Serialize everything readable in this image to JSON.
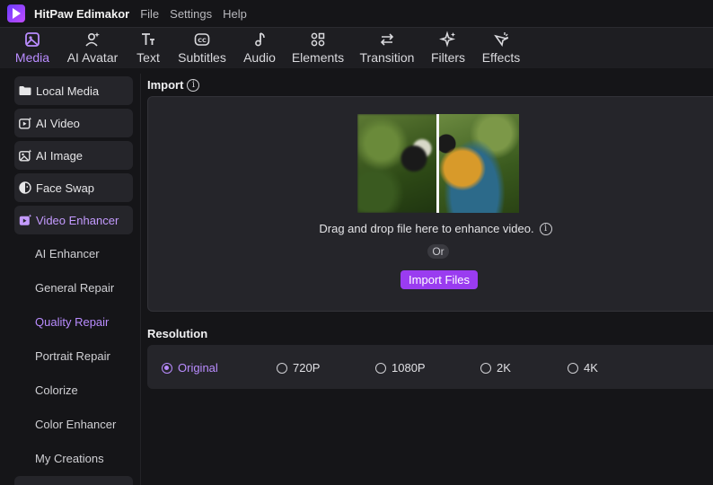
{
  "app": {
    "name": "HitPaw Edimakor",
    "menu": [
      "File",
      "Settings",
      "Help"
    ]
  },
  "toolbar": {
    "tabs": [
      {
        "label": "Media",
        "icon": "media-icon",
        "active": true
      },
      {
        "label": "AI Avatar",
        "icon": "avatar-icon"
      },
      {
        "label": "Text",
        "icon": "text-icon"
      },
      {
        "label": "Subtitles",
        "icon": "subtitles-icon"
      },
      {
        "label": "Audio",
        "icon": "audio-icon"
      },
      {
        "label": "Elements",
        "icon": "elements-icon"
      },
      {
        "label": "Transition",
        "icon": "transition-icon"
      },
      {
        "label": "Filters",
        "icon": "filters-icon"
      },
      {
        "label": "Effects",
        "icon": "effects-icon"
      }
    ]
  },
  "sidebar": {
    "items": [
      {
        "label": "Local Media",
        "icon": "folder-icon"
      },
      {
        "label": "AI Video",
        "icon": "ai-video-icon"
      },
      {
        "label": "AI Image",
        "icon": "ai-image-icon"
      },
      {
        "label": "Face Swap",
        "icon": "face-swap-icon"
      },
      {
        "label": "Video Enhancer",
        "icon": "video-enhancer-icon",
        "active": true
      }
    ],
    "sub_items": [
      {
        "label": "AI Enhancer"
      },
      {
        "label": "General Repair"
      },
      {
        "label": "Quality Repair",
        "active": true
      },
      {
        "label": "Portrait Repair"
      },
      {
        "label": "Colorize"
      },
      {
        "label": "Color Enhancer"
      },
      {
        "label": "My Creations"
      }
    ]
  },
  "import": {
    "title": "Import",
    "drop_text": "Drag and drop file here to enhance video.",
    "or_text": "Or",
    "button_label": "Import Files"
  },
  "resolution": {
    "title": "Resolution",
    "options": [
      {
        "label": "Original",
        "checked": true
      },
      {
        "label": "720P"
      },
      {
        "label": "1080P"
      },
      {
        "label": "2K"
      },
      {
        "label": "4K"
      }
    ]
  },
  "colors": {
    "accent": "#b98cff",
    "button": "#9a3cf0",
    "background": "#151518",
    "panel": "#25252a"
  }
}
